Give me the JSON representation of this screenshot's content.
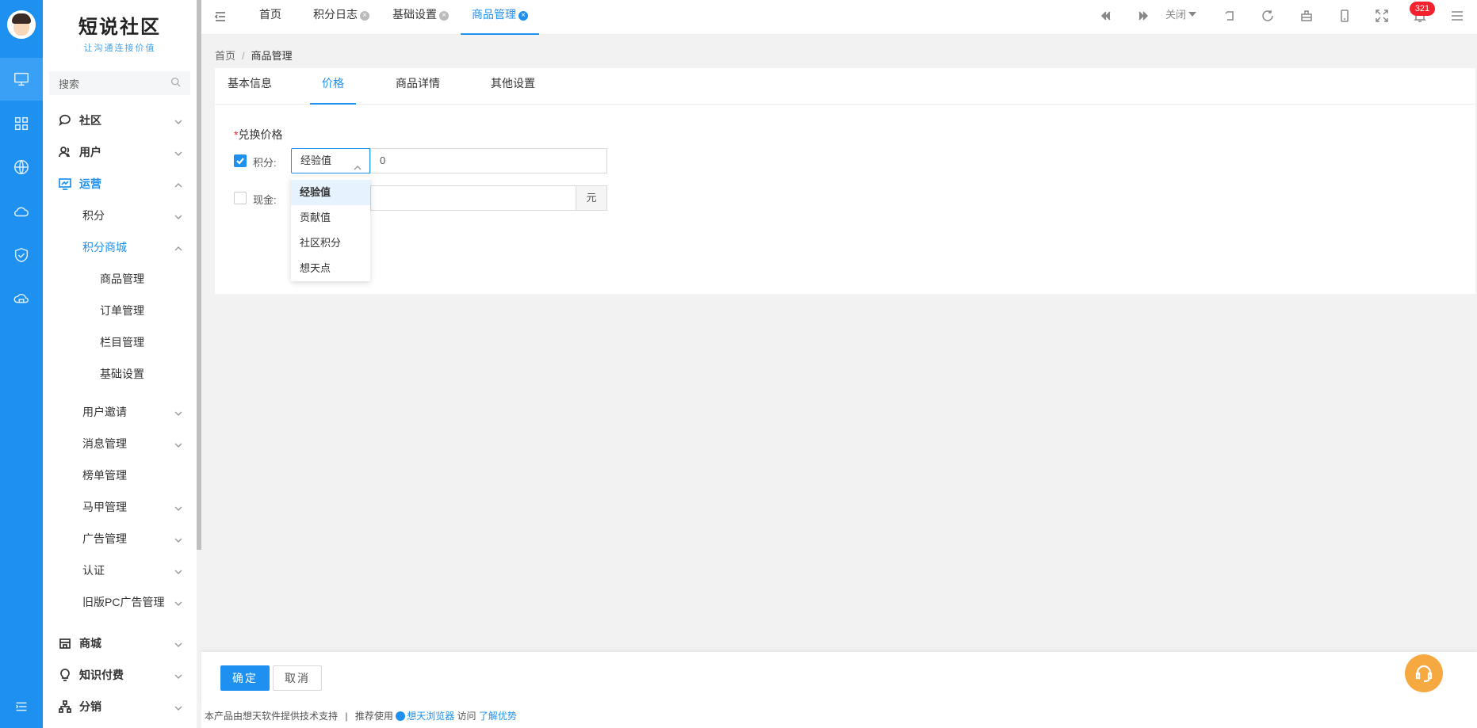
{
  "brand": {
    "title": "短说社区",
    "slogan": "让沟通连接价值"
  },
  "search": {
    "placeholder": "搜索"
  },
  "sidebar": {
    "items": [
      {
        "label": "社区",
        "icon": "chat-bubble-icon"
      },
      {
        "label": "用户",
        "icon": "users-icon"
      },
      {
        "label": "运营",
        "icon": "monitor-chart-icon"
      },
      {
        "label": "积分"
      },
      {
        "label": "积分商城"
      },
      {
        "label": "商品管理"
      },
      {
        "label": "订单管理"
      },
      {
        "label": "栏目管理"
      },
      {
        "label": "基础设置"
      },
      {
        "label": "用户邀请"
      },
      {
        "label": "消息管理"
      },
      {
        "label": "榜单管理"
      },
      {
        "label": "马甲管理"
      },
      {
        "label": "广告管理"
      },
      {
        "label": "认证"
      },
      {
        "label": "旧版PC广告管理"
      },
      {
        "label": "商城",
        "icon": "store-icon"
      },
      {
        "label": "知识付费",
        "icon": "lightbulb-icon"
      },
      {
        "label": "分销",
        "icon": "sitemap-icon"
      }
    ]
  },
  "tabs": [
    {
      "label": "首页"
    },
    {
      "label": "积分日志"
    },
    {
      "label": "基础设置"
    },
    {
      "label": "商品管理"
    }
  ],
  "toolbar": {
    "close_label": "关闭",
    "notifications_count": "321"
  },
  "breadcrumb": {
    "home": "首页",
    "separator": "/",
    "current": "商品管理"
  },
  "panel_tabs": [
    {
      "label": "基本信息"
    },
    {
      "label": "价格"
    },
    {
      "label": "商品详情"
    },
    {
      "label": "其他设置"
    }
  ],
  "form": {
    "required_mark": "*",
    "section_title": "兑换价格",
    "points_label": "积分:",
    "points_type_selected": "经验值",
    "points_value": "0",
    "cash_label": "现金:",
    "cash_unit": "元",
    "points_type_options": [
      "经验值",
      "贡献值",
      "社区积分",
      "想天点"
    ]
  },
  "actions": {
    "ok": "确定",
    "cancel": "取消"
  },
  "footer": {
    "provider": "本产品由想天软件提供技术支持",
    "sep": "|",
    "recommend": "推荐使用",
    "browser": "想天浏览器",
    "visit": "访问",
    "advantages": "了解优势"
  },
  "colors": {
    "primary": "#1e90f0",
    "badge": "#f5222d",
    "support": "#f7a941"
  }
}
